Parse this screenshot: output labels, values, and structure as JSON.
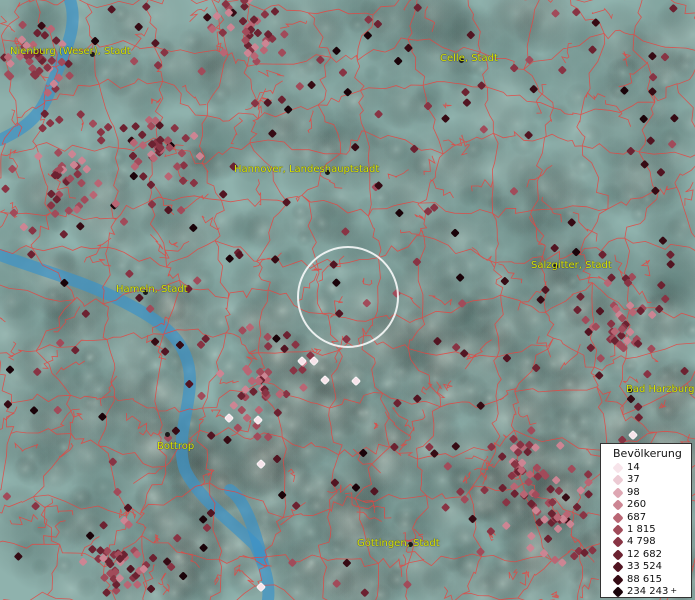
{
  "cities": [
    {
      "name": "Nienburg (Weser), Stadt",
      "dot": true
    },
    {
      "name": "Celle, Stadt",
      "dot": true
    },
    {
      "name": "Hannover, Landeshauptstadt",
      "dot": true
    },
    {
      "name": "Salzgitter, Stadt",
      "dot": true
    },
    {
      "name": "Hameln, Stadt",
      "dot": true
    },
    {
      "name": "Bad Harzburg",
      "dot": true
    },
    {
      "name": "Bottrop",
      "dot": true
    },
    {
      "name": "Göttingen, Stadt",
      "dot": true
    }
  ],
  "legend": {
    "title": "Bevölkerung",
    "entries": [
      {
        "label": "14",
        "color": "#f7e4ea"
      },
      {
        "label": "37",
        "color": "#eccad3"
      },
      {
        "label": "98",
        "color": "#dea7b3"
      },
      {
        "label": "260",
        "color": "#cc8593"
      },
      {
        "label": "687",
        "color": "#b96674"
      },
      {
        "label": "1 815",
        "color": "#a14b5a"
      },
      {
        "label": "4 798",
        "color": "#883444"
      },
      {
        "label": "12 682",
        "color": "#6c2231"
      },
      {
        "label": "33 524",
        "color": "#521522",
        "plus": ""
      },
      {
        "label": "88 615",
        "color": "#360b14"
      },
      {
        "label": "234 243",
        "color": "#1a0309",
        "plus": "+"
      }
    ]
  },
  "selection_circle": true
}
